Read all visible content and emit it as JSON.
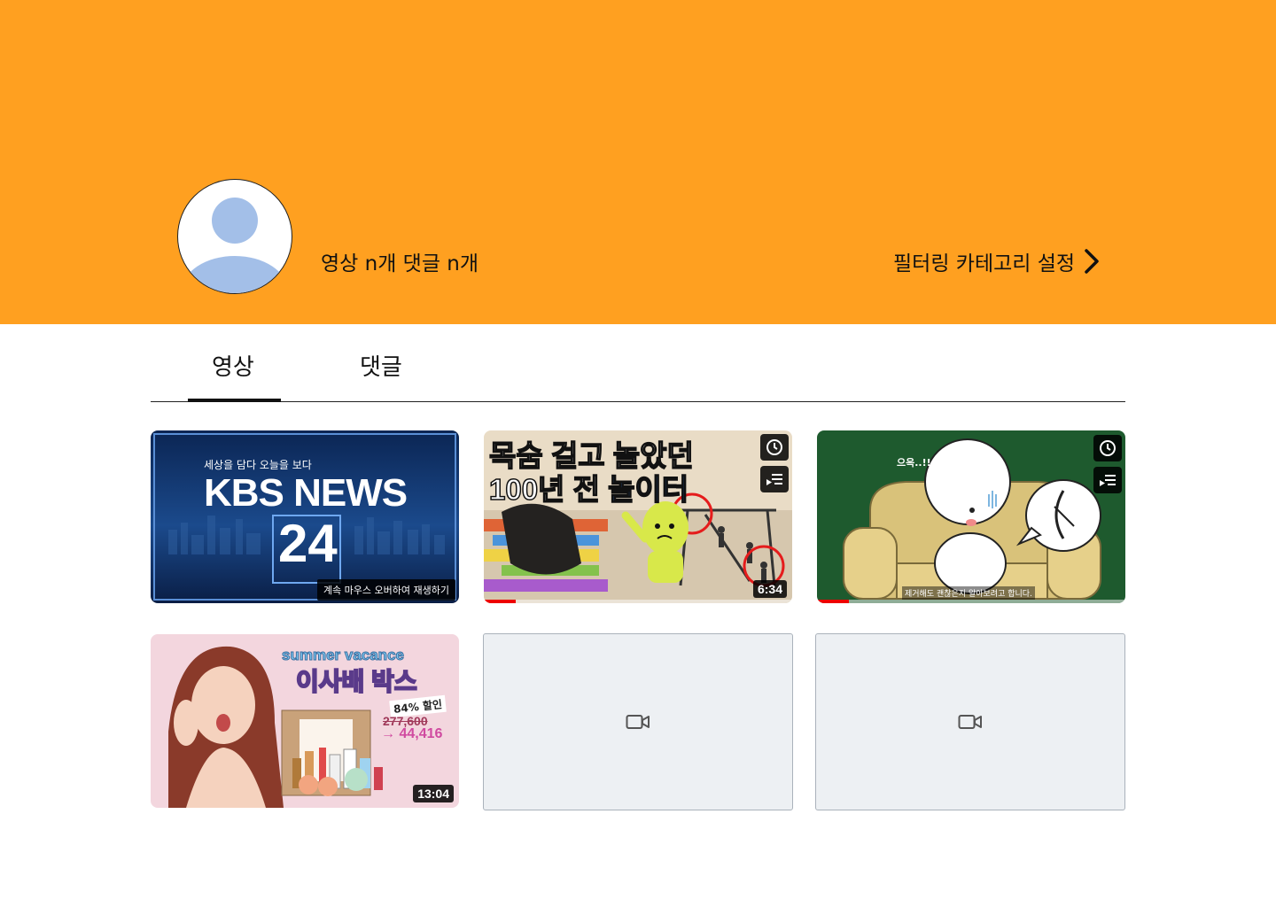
{
  "header": {
    "background_color": "#FFA020",
    "stats_text": "영상 n개 댓글 n개",
    "filter_link_label": "필터링 카테고리 설정",
    "filter_link_icon": "chevron-right-icon"
  },
  "tabs": {
    "items": [
      {
        "label": "영상",
        "active": true
      },
      {
        "label": "댓글",
        "active": false
      }
    ]
  },
  "videos": [
    {
      "thumbnail": "KBS NEWS 24 channel graphic",
      "tagline": "세상을 담다 오늘을 보다",
      "brand": "KBS NEWS",
      "number": "24",
      "hover_note": "계속 마우스 오버하여 재생하기"
    },
    {
      "thumbnail": "cartoon about old playgrounds",
      "title_line1": "목숨 걸고 놀았던",
      "title_line2_a": "100년 전",
      "title_line2_b": "놀이터",
      "duration": "6:34",
      "progress": 0.1,
      "icons": [
        "watch-later-icon",
        "add-to-queue-icon"
      ]
    },
    {
      "thumbnail": "cartoon character on a sofa",
      "speech": "으윽..!!",
      "caption": "제거해도 괜찮은지 알아보려고 합니다.",
      "progress": 0.1,
      "icons": [
        "watch-later-icon",
        "add-to-queue-icon"
      ]
    },
    {
      "thumbnail": "cosmetics promotion",
      "banner_en": "summer vacance",
      "banner_ko": "이사배 박스",
      "discount": "84% 할인",
      "old_price": "277,600",
      "new_price": "→ 44,416",
      "duration": "13:04"
    },
    {
      "thumbnail": "placeholder",
      "icon": "video-camera-icon"
    },
    {
      "thumbnail": "placeholder",
      "icon": "video-camera-icon"
    }
  ]
}
